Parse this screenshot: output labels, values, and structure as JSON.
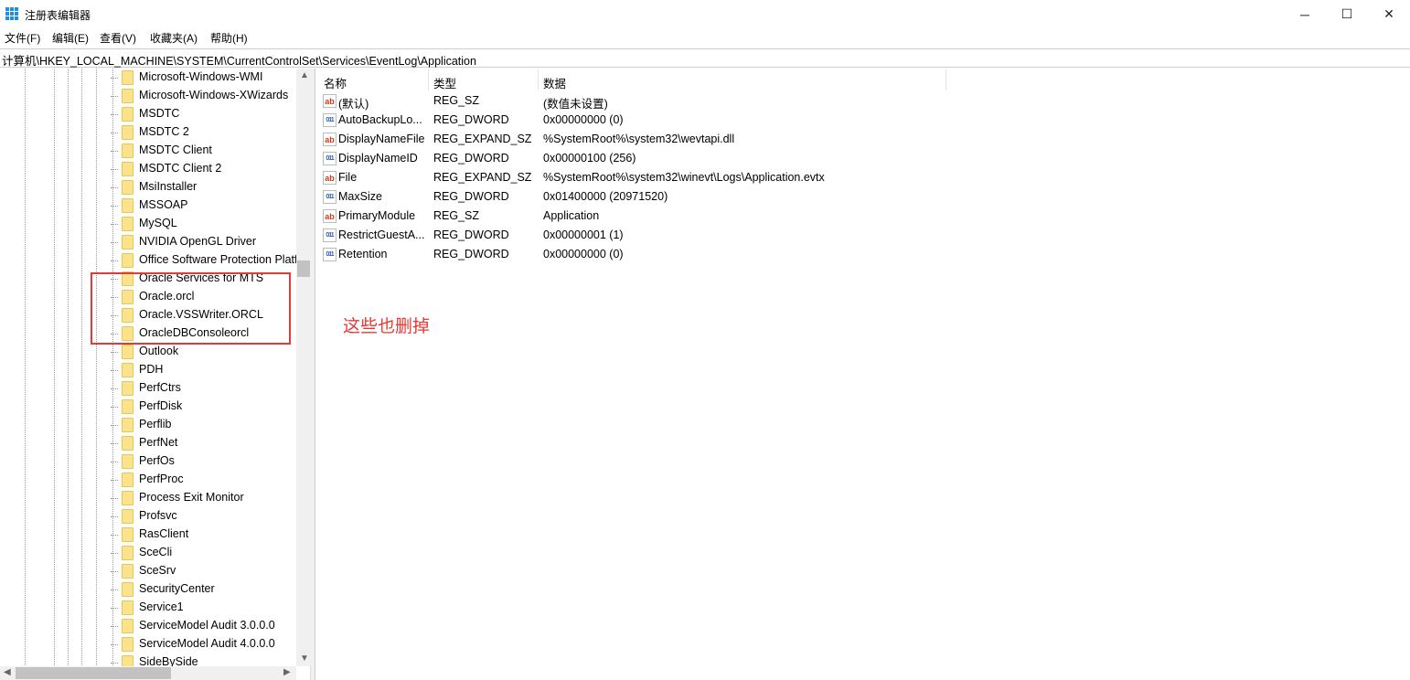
{
  "window": {
    "title": "注册表编辑器",
    "minimize": "─",
    "maximize": "☐",
    "close": "✕"
  },
  "menu": [
    "文件(F)",
    "编辑(E)",
    "查看(V)",
    "收藏夹(A)",
    "帮助(H)"
  ],
  "address": "计算机\\HKEY_LOCAL_MACHINE\\SYSTEM\\CurrentControlSet\\Services\\EventLog\\Application",
  "tree": [
    "Microsoft-Windows-WMI",
    "Microsoft-Windows-XWizards",
    "MSDTC",
    "MSDTC 2",
    "MSDTC Client",
    "MSDTC Client 2",
    "MsiInstaller",
    "MSSOAP",
    "MySQL",
    "NVIDIA OpenGL Driver",
    "Office Software Protection Platform",
    "Oracle Services for MTS",
    "Oracle.orcl",
    "Oracle.VSSWriter.ORCL",
    "OracleDBConsoleorcl",
    "Outlook",
    "PDH",
    "PerfCtrs",
    "PerfDisk",
    "Perflib",
    "PerfNet",
    "PerfOs",
    "PerfProc",
    "Process Exit Monitor",
    "Profsvc",
    "RasClient",
    "SceCli",
    "SceSrv",
    "SecurityCenter",
    "Service1",
    "ServiceModel Audit 3.0.0.0",
    "ServiceModel Audit 4.0.0.0",
    "SideBySide"
  ],
  "columns": {
    "name": "名称",
    "type": "类型",
    "data": "数据"
  },
  "values": [
    {
      "icon": "ab",
      "name": "(默认)",
      "type": "REG_SZ",
      "data": "(数值未设置)"
    },
    {
      "icon": "bin",
      "name": "AutoBackupLo...",
      "type": "REG_DWORD",
      "data": "0x00000000 (0)"
    },
    {
      "icon": "ab",
      "name": "DisplayNameFile",
      "type": "REG_EXPAND_SZ",
      "data": "%SystemRoot%\\system32\\wevtapi.dll"
    },
    {
      "icon": "bin",
      "name": "DisplayNameID",
      "type": "REG_DWORD",
      "data": "0x00000100 (256)"
    },
    {
      "icon": "ab",
      "name": "File",
      "type": "REG_EXPAND_SZ",
      "data": "%SystemRoot%\\system32\\winevt\\Logs\\Application.evtx"
    },
    {
      "icon": "bin",
      "name": "MaxSize",
      "type": "REG_DWORD",
      "data": "0x01400000 (20971520)"
    },
    {
      "icon": "ab",
      "name": "PrimaryModule",
      "type": "REG_SZ",
      "data": "Application"
    },
    {
      "icon": "bin",
      "name": "RestrictGuestA...",
      "type": "REG_DWORD",
      "data": "0x00000001 (1)"
    },
    {
      "icon": "bin",
      "name": "Retention",
      "type": "REG_DWORD",
      "data": "0x00000000 (0)"
    }
  ],
  "annotation": {
    "text": "这些也删掉",
    "color": "#e53935"
  },
  "icon_text": {
    "ab": "ab",
    "bin": "011"
  }
}
